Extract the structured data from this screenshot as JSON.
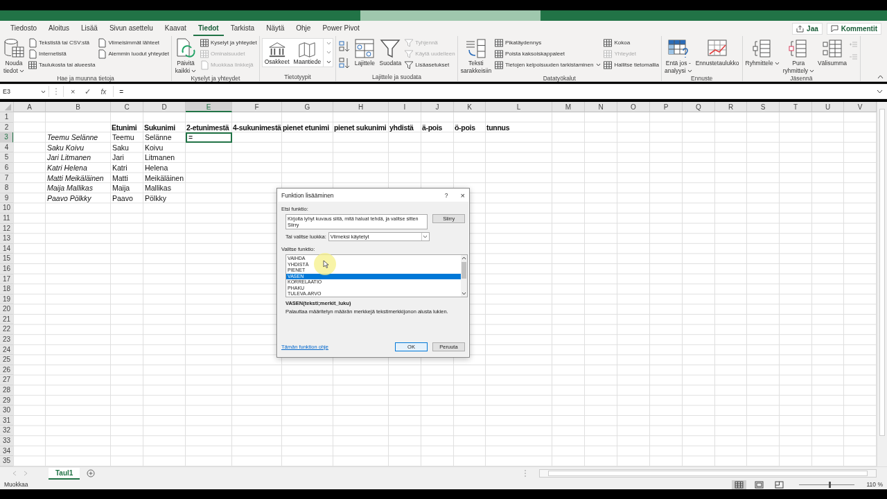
{
  "ribbon": {
    "tabs": [
      {
        "label": "Tiedosto",
        "selected": false
      },
      {
        "label": "Aloitus",
        "selected": false
      },
      {
        "label": "Lisää",
        "selected": false
      },
      {
        "label": "Sivun asettelu",
        "selected": false
      },
      {
        "label": "Kaavat",
        "selected": false
      },
      {
        "label": "Tiedot",
        "selected": true
      },
      {
        "label": "Tarkista",
        "selected": false
      },
      {
        "label": "Näytä",
        "selected": false
      },
      {
        "label": "Ohje",
        "selected": false
      },
      {
        "label": "Power Pivot",
        "selected": false
      }
    ],
    "share_button": "Jaa",
    "comments_button": "Kommentit",
    "groups": [
      {
        "label": "Hae ja muunna tietoja",
        "columns": [
          {
            "kind": "large",
            "label": "Nouda\ntiedot",
            "menu": true
          },
          {
            "kind": "stack",
            "items": [
              {
                "label": "Tekstistä tai CSV:stä",
                "disabled": false
              },
              {
                "label": "Internetistä",
                "disabled": false
              },
              {
                "label": "Taulukosta tai alueesta",
                "disabled": false
              }
            ]
          },
          {
            "kind": "stack",
            "items": [
              {
                "label": "Viimeisimmät lähteet",
                "disabled": false
              },
              {
                "label": "Aiemmin luodut yhteydet",
                "disabled": false
              }
            ]
          }
        ]
      },
      {
        "label": "Kyselyt ja yhteydet",
        "columns": [
          {
            "kind": "large",
            "label": "Päivitä\nkaikki",
            "menu": true
          },
          {
            "kind": "stack",
            "items": [
              {
                "label": "Kyselyt ja yhteydet",
                "disabled": false
              },
              {
                "label": "Ominaisuudet",
                "disabled": true
              },
              {
                "label": "Muokkaa linkkejä",
                "disabled": true
              }
            ]
          }
        ]
      },
      {
        "label": "Tietotyypit",
        "columns": [
          {
            "kind": "gallery",
            "items": [
              {
                "label": "Osakkeet"
              },
              {
                "label": "Maantiede"
              }
            ]
          }
        ]
      },
      {
        "label": "Lajittele ja suodata",
        "columns": [
          {
            "kind": "sort_pair"
          },
          {
            "kind": "large",
            "label": "Lajittele"
          },
          {
            "kind": "large",
            "label": "Suodata"
          },
          {
            "kind": "stack",
            "items": [
              {
                "label": "Tyhjennä",
                "disabled": true
              },
              {
                "label": "Käytä uudelleen",
                "disabled": true
              },
              {
                "label": "Lisäasetukset",
                "disabled": false
              }
            ]
          }
        ]
      },
      {
        "label": "Datatyökalut",
        "columns": [
          {
            "kind": "large",
            "label": "Teksti\nsarakkeisiin"
          },
          {
            "kind": "stack",
            "items": [
              {
                "label": "Pikatäydennys",
                "disabled": false
              },
              {
                "label": "Poista kaksoiskappaleet",
                "disabled": false
              },
              {
                "label": "Tietojen kelpoisuuden tarkistaminen",
                "disabled": false,
                "menu": true
              }
            ]
          },
          {
            "kind": "stack",
            "items": [
              {
                "label": "Kokoa",
                "disabled": false
              },
              {
                "label": "Yhteydet",
                "disabled": true
              },
              {
                "label": "Hallitse tietomallia",
                "disabled": false
              }
            ]
          }
        ]
      },
      {
        "label": "Ennuste",
        "columns": [
          {
            "kind": "large",
            "label": "Entä jos -\nanalyysi",
            "menu": true
          },
          {
            "kind": "large",
            "label": "Ennustetaulukko"
          }
        ]
      },
      {
        "label": "Jäsennä",
        "columns": [
          {
            "kind": "large",
            "label": "Ryhmittele",
            "menu": true
          },
          {
            "kind": "large",
            "label": "Pura\nryhmittely",
            "menu": true
          },
          {
            "kind": "large",
            "label": "Välisumma"
          },
          {
            "kind": "detail_pair"
          }
        ]
      }
    ]
  },
  "formula_bar": {
    "name_box": "E3",
    "cancel": "×",
    "enter": "✓",
    "function": "fx",
    "formula": "="
  },
  "sheet": {
    "columns": [
      {
        "label": "A",
        "selected": false
      },
      {
        "label": "B",
        "selected": false
      },
      {
        "label": "C",
        "selected": false
      },
      {
        "label": "D",
        "selected": false
      },
      {
        "label": "E",
        "selected": true
      },
      {
        "label": "F",
        "selected": false
      },
      {
        "label": "G",
        "selected": false
      },
      {
        "label": "H",
        "selected": false
      },
      {
        "label": "I",
        "selected": false
      },
      {
        "label": "J",
        "selected": false
      },
      {
        "label": "K",
        "selected": false
      },
      {
        "label": "L",
        "selected": false
      },
      {
        "label": "M",
        "selected": false
      },
      {
        "label": "N",
        "selected": false
      },
      {
        "label": "O",
        "selected": false
      },
      {
        "label": "P",
        "selected": false
      },
      {
        "label": "Q",
        "selected": false
      },
      {
        "label": "R",
        "selected": false
      },
      {
        "label": "S",
        "selected": false
      },
      {
        "label": "T",
        "selected": false
      },
      {
        "label": "U",
        "selected": false
      },
      {
        "label": "V",
        "selected": false
      }
    ],
    "rows": [
      {
        "number": "1",
        "selected": false
      },
      {
        "number": "2",
        "selected": false,
        "kind": "header",
        "cells": [
          {
            "text": "Etunimi",
            "selected": false
          },
          {
            "text": "Sukunimi",
            "selected": false
          },
          {
            "text": "2-etunimestä",
            "selected": false
          },
          {
            "text": "4-sukunimestä",
            "selected": false
          },
          {
            "text": "pienet etunimi",
            "selected": false
          },
          {
            "text": "pienet sukunimi",
            "selected": false
          },
          {
            "text": "yhdistä",
            "selected": false
          },
          {
            "text": "ä-pois",
            "selected": false
          },
          {
            "text": "ö-pois",
            "selected": false
          },
          {
            "text": "tunnus",
            "selected": false
          }
        ]
      },
      {
        "number": "3",
        "selected": true,
        "kind": "record",
        "cells": [
          {
            "text": "Teemu Selänne",
            "selected": false
          },
          {
            "text": "Teemu",
            "selected": false
          },
          {
            "text": "Selänne",
            "selected": false
          },
          {
            "text": "=",
            "selected": true
          }
        ]
      },
      {
        "number": "4",
        "selected": false,
        "kind": "record",
        "cells": [
          {
            "text": "Saku Koivu",
            "selected": false
          },
          {
            "text": "Saku",
            "selected": false
          },
          {
            "text": "Koivu",
            "selected": false
          }
        ]
      },
      {
        "number": "5",
        "selected": false,
        "kind": "record",
        "cells": [
          {
            "text": "Jari Litmanen",
            "selected": false
          },
          {
            "text": "Jari",
            "selected": false
          },
          {
            "text": "Litmanen",
            "selected": false
          }
        ]
      },
      {
        "number": "6",
        "selected": false,
        "kind": "record",
        "cells": [
          {
            "text": "Katri Helena",
            "selected": false
          },
          {
            "text": "Katri",
            "selected": false
          },
          {
            "text": "Helena",
            "selected": false
          }
        ]
      },
      {
        "number": "7",
        "selected": false,
        "kind": "record",
        "cells": [
          {
            "text": "Matti Meikäläinen",
            "selected": false
          },
          {
            "text": "Matti",
            "selected": false
          },
          {
            "text": "Meikäläinen",
            "selected": false
          }
        ]
      },
      {
        "number": "8",
        "selected": false,
        "kind": "record",
        "cells": [
          {
            "text": "Maija Mallikas",
            "selected": false
          },
          {
            "text": "Maija",
            "selected": false
          },
          {
            "text": "Mallikas",
            "selected": false
          }
        ]
      },
      {
        "number": "9",
        "selected": false,
        "kind": "record",
        "cells": [
          {
            "text": "Paavo Pölkky",
            "selected": false
          },
          {
            "text": "Paavo",
            "selected": false
          },
          {
            "text": "Pölkky",
            "selected": false
          }
        ]
      },
      {
        "number": "10",
        "selected": false
      },
      {
        "number": "11",
        "selected": false
      },
      {
        "number": "12",
        "selected": false
      },
      {
        "number": "13",
        "selected": false
      },
      {
        "number": "14",
        "selected": false
      },
      {
        "number": "15",
        "selected": false
      },
      {
        "number": "16",
        "selected": false
      },
      {
        "number": "17",
        "selected": false
      },
      {
        "number": "18",
        "selected": false
      },
      {
        "number": "19",
        "selected": false
      },
      {
        "number": "20",
        "selected": false
      },
      {
        "number": "21",
        "selected": false
      },
      {
        "number": "22",
        "selected": false
      },
      {
        "number": "23",
        "selected": false
      },
      {
        "number": "24",
        "selected": false
      },
      {
        "number": "25",
        "selected": false
      },
      {
        "number": "26",
        "selected": false
      },
      {
        "number": "27",
        "selected": false
      },
      {
        "number": "28",
        "selected": false
      },
      {
        "number": "29",
        "selected": false
      },
      {
        "number": "30",
        "selected": false
      },
      {
        "number": "31",
        "selected": false
      },
      {
        "number": "32",
        "selected": false
      },
      {
        "number": "33",
        "selected": false
      },
      {
        "number": "34",
        "selected": false
      },
      {
        "number": "35",
        "selected": false
      }
    ]
  },
  "dialog": {
    "title": "Funktion lisääminen",
    "help": "?",
    "close": "×",
    "search_label": "Etsi funktio:",
    "search_value": "Kirjoita lyhyt kuvaus siitä, mitä haluat tehdä, ja valitse sitten Siirry",
    "go_button": "Siirry",
    "category_label": "Tai valitse luokka:",
    "category_value": "Viimeksi käytetyt",
    "list_label": "Valitse funktio:",
    "functions": [
      {
        "label": "VAIHDA",
        "selected": false
      },
      {
        "label": "YHDISTÄ",
        "selected": false
      },
      {
        "label": "PIENET",
        "selected": false
      },
      {
        "label": "VASEN",
        "selected": true
      },
      {
        "label": "KORRELAATIO",
        "selected": false
      },
      {
        "label": "PHAKU",
        "selected": false
      },
      {
        "label": "TULEVA.ARVO",
        "selected": false
      }
    ],
    "signature": "VASEN(teksti;merkit_luku)",
    "description": "Palauttaa määritetyn määrän merkkejä tekstimerkkijonon alusta lukien.",
    "help_link": "Tämän funktion ohje",
    "ok_button": "OK",
    "cancel_button": "Peruuta"
  },
  "sheet_tabs": [
    {
      "label": "Taul1",
      "selected": true
    }
  ],
  "status_bar": {
    "mode": "Muokkaa",
    "views": [
      {
        "kind": "normal",
        "selected": true
      },
      {
        "kind": "page_layout",
        "selected": false
      },
      {
        "kind": "page_break",
        "selected": false
      }
    ],
    "zoom": {
      "level": 0.56,
      "label": "110 %"
    }
  }
}
